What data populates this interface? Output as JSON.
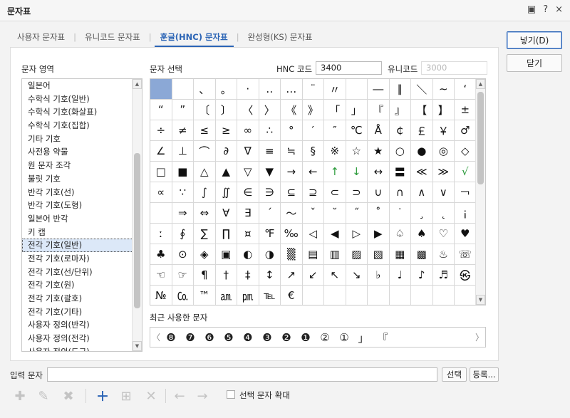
{
  "window": {
    "title": "문자표",
    "buttons": [
      "▣",
      "?",
      "×"
    ]
  },
  "tabs": [
    {
      "label": "사용자 문자표"
    },
    {
      "label": "유니코드 문자표"
    },
    {
      "label": "훈글(HNC) 문자표"
    },
    {
      "label": "완성형(KS) 문자표"
    }
  ],
  "actions": {
    "insert_label": "넣기(D)",
    "close_label": "닫기"
  },
  "category": {
    "heading": "문자 영역",
    "items": [
      "일본어",
      "수학식 기호(일반)",
      "수학식 기호(화살표)",
      "수학식 기호(집합)",
      "기타 기호",
      "사전용 약물",
      "원 문자 조각",
      "불릿 기호",
      "반각 기호(선)",
      "반각 기호(도형)",
      "일본어 반각",
      "키 캡",
      "전각 기호(일반)",
      "전각 기호(로마자)",
      "전각 기호(선/단위)",
      "전각 기호(원)",
      "전각 기호(괄호)",
      "전각 기호(기타)",
      "사용자 정의(반각)",
      "사용자 정의(전각)",
      "사용자 정의(도구)"
    ],
    "selected_index": 12
  },
  "char_select": {
    "heading": "문자 선택",
    "hnc_label": "HNC 코드",
    "hnc_value": "3400",
    "unicode_label": "유니코드",
    "unicode_value": "3000"
  },
  "grid": {
    "selected_cell": "0-0",
    "rows": [
      [
        " ",
        "　",
        "、",
        "。",
        "·",
        "‥",
        "…",
        "¨",
        "〃",
        "­",
        "―",
        "∥",
        "＼",
        "∼",
        "‘",
        "’"
      ],
      [
        "“",
        "”",
        "〔",
        "〕",
        "〈",
        "〉",
        "《",
        "》",
        "「",
        "」",
        "『",
        "』",
        "【",
        "】",
        "±",
        "×"
      ],
      [
        "÷",
        "≠",
        "≤",
        "≥",
        "∞",
        "∴",
        "°",
        "′",
        "″",
        "℃",
        "Å",
        "￠",
        "￡",
        "￥",
        "♂",
        "♀"
      ],
      [
        "∠",
        "⊥",
        "⌒",
        "∂",
        "∇",
        "≡",
        "≒",
        "§",
        "※",
        "☆",
        "★",
        "○",
        "●",
        "◎",
        "◇",
        "◆"
      ],
      [
        "□",
        "■",
        "△",
        "▲",
        "▽",
        "▼",
        "→",
        "←",
        "↑",
        "↓",
        "↔",
        "〓",
        "≪",
        "≫",
        "√",
        "∽"
      ],
      [
        "∝",
        "∵",
        "∫",
        "∬",
        "∈",
        "∋",
        "⊆",
        "⊇",
        "⊂",
        "⊃",
        "∪",
        "∩",
        "∧",
        "∨",
        "￢",
        ""
      ],
      [
        "",
        "⇒",
        "⇔",
        "∀",
        "∃",
        "´",
        "～",
        "ˇ",
        "˘",
        "˝",
        "˚",
        "˙",
        "¸",
        "˛",
        "¡",
        "¿"
      ],
      [
        "ː",
        "∮",
        "∑",
        "∏",
        "¤",
        "℉",
        "‰",
        "◁",
        "◀",
        "▷",
        "▶",
        "♤",
        "♠",
        "♡",
        "♥",
        "♧"
      ],
      [
        "♣",
        "⊙",
        "◈",
        "▣",
        "◐",
        "◑",
        "▒",
        "▤",
        "▥",
        "▨",
        "▧",
        "▦",
        "▩",
        "♨",
        "☏",
        "☎"
      ],
      [
        "☜",
        "☞",
        "¶",
        "†",
        "‡",
        "↕",
        "↗",
        "↙",
        "↖",
        "↘",
        "♭",
        "♩",
        "♪",
        "♬",
        "㉿",
        "㈜"
      ],
      [
        "№",
        "㏇",
        "™",
        "㏂",
        "㏘",
        "℡",
        "€",
        "",
        "",
        "",
        "",
        "",
        "",
        "",
        "",
        ""
      ]
    ]
  },
  "recent": {
    "label": "최근 사용한 문자",
    "chars": [
      "❽",
      "❼",
      "❻",
      "❺",
      "❹",
      "❸",
      "❷",
      "❶",
      "②",
      "①",
      "」",
      "『"
    ],
    "prev": "〈",
    "next": "〉"
  },
  "input": {
    "label": "입력 문자",
    "value": "",
    "select_label": "선택",
    "register_label": "등록..."
  },
  "toolbar": {
    "expand_label": "선택 문자 확대"
  }
}
